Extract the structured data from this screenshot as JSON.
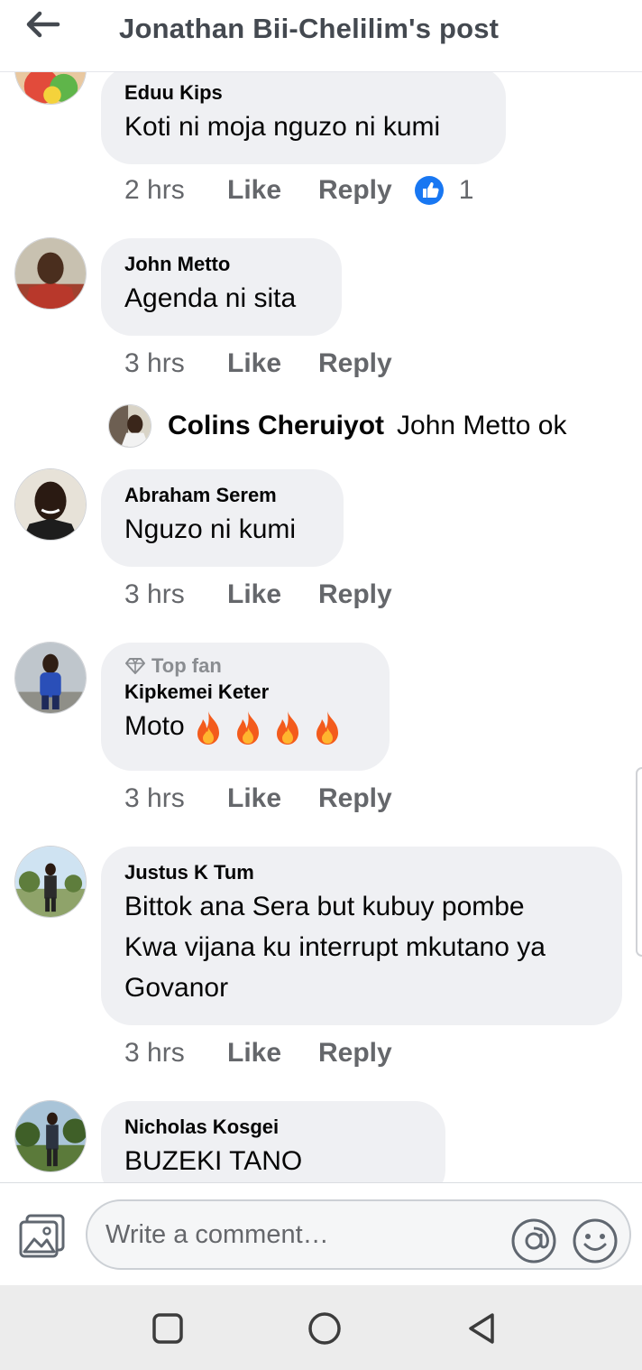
{
  "header": {
    "title": "Jonathan Bii-Chelilim's post",
    "back_icon": "arrow-left-icon"
  },
  "comments": [
    {
      "author": "Eduu Kips",
      "text": "Koti ni moja nguzo ni kumi",
      "time": "2 hrs",
      "like_label": "Like",
      "reply_label": "Reply",
      "reaction_count": "1",
      "reaction_icon": "thumbs-up-icon"
    },
    {
      "author": "John Metto",
      "text": "Agenda ni sita",
      "time": "3 hrs",
      "like_label": "Like",
      "reply_label": "Reply",
      "reply_preview": {
        "author": "Colins Cheruiyot",
        "text": "John Metto ok"
      }
    },
    {
      "author": "Abraham Serem",
      "text": "Nguzo ni kumi",
      "time": "3 hrs",
      "like_label": "Like",
      "reply_label": "Reply"
    },
    {
      "badge": "Top fan",
      "badge_icon": "diamond-icon",
      "author": "Kipkemei Keter",
      "text": "Moto",
      "emoji": [
        "fire",
        "fire",
        "fire",
        "fire"
      ],
      "time": "3 hrs",
      "like_label": "Like",
      "reply_label": "Reply"
    },
    {
      "author": "Justus K Tum",
      "text_lines": [
        "Bittok ana Sera but kubuy pombe",
        "Kwa vijana ku interrupt mkutano ya",
        "Govanor"
      ],
      "time": "3 hrs",
      "like_label": "Like",
      "reply_label": "Reply"
    },
    {
      "author": "Nicholas Kosgei",
      "text": "BUZEKI TANO"
    }
  ],
  "composer": {
    "placeholder": "Write a comment…",
    "photo_icon": "photo-icon",
    "mention_icon": "at-sign-icon",
    "emoji_icon": "smiley-icon"
  },
  "system_nav": {
    "recents_icon": "square-icon",
    "home_icon": "circle-icon",
    "back_icon": "triangle-back-icon"
  },
  "colors": {
    "bubble": "#eff0f3",
    "secondary_text": "#65676b",
    "like_blue": "#1877f2",
    "fire": "#f35b1c"
  }
}
